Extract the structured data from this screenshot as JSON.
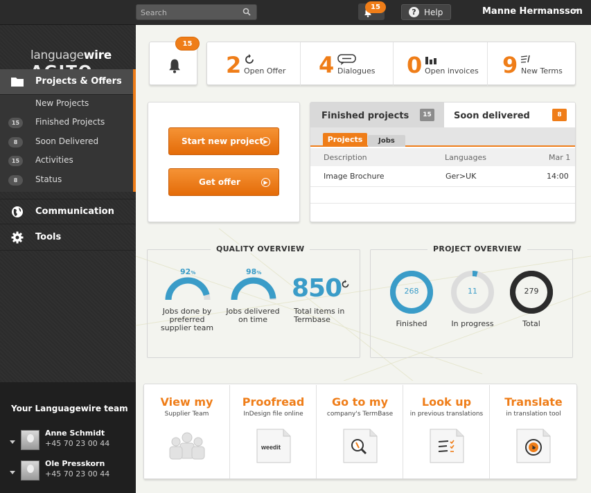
{
  "topbar": {
    "search_placeholder": "Search",
    "notification_count": "15",
    "help_label": "Help",
    "user_name": "Manne Hermansson"
  },
  "logo": {
    "line1_light": "language",
    "line1_bold": "wire",
    "line2": "AGITO"
  },
  "sidebar": {
    "projects_label": "Projects & Offers",
    "sub_items": [
      {
        "badge": "",
        "label": "New Projects"
      },
      {
        "badge": "15",
        "label": "Finished Projects"
      },
      {
        "badge": "8",
        "label": "Soon Delivered"
      },
      {
        "badge": "15",
        "label": "Activities"
      },
      {
        "badge": "8",
        "label": "Status"
      }
    ],
    "communication_label": "Communication",
    "tools_label": "Tools",
    "team_title": "Your Languagewire team",
    "team": [
      {
        "name": "Anne Schmidt",
        "phone": "+45 70 23 00 44"
      },
      {
        "name": "Ole Presskorn",
        "phone": "+45 70 23 00 44"
      }
    ]
  },
  "stats": {
    "bell_count": "15",
    "items": [
      {
        "value": "2",
        "label": "Open Offer",
        "icon": "refresh-icon"
      },
      {
        "value": "4",
        "label": "Dialogues",
        "icon": "speech-bubble-icon"
      },
      {
        "value": "0",
        "label": "Open invoices",
        "icon": "bar-chart-icon"
      },
      {
        "value": "9",
        "label": "New Terms",
        "icon": "list-pen-icon"
      }
    ]
  },
  "actions_card": {
    "start_label": "Start new project",
    "offer_label": "Get offer"
  },
  "projects_panel": {
    "finished_label": "Finished projects",
    "finished_count": "15",
    "soon_label": "Soon delivered",
    "soon_count": "8",
    "tab_projects": "Projects",
    "tab_jobs": "Jobs",
    "columns": {
      "description": "Description",
      "languages": "Languages",
      "date": "Mar 1"
    },
    "rows": [
      {
        "description": "Image Brochure",
        "languages": "Ger>UK",
        "time": "14:00"
      }
    ]
  },
  "quality": {
    "title": "QUALITY OVERVIEW",
    "gauges": [
      {
        "value": "92",
        "unit": "%",
        "fraction": 0.92,
        "label": "Jobs done by preferred supplier team"
      },
      {
        "value": "98",
        "unit": "%",
        "fraction": 0.98,
        "label": "Jobs delivered on time"
      }
    ],
    "total_value": "850",
    "total_label": "Total items in Termbase"
  },
  "project_overview": {
    "title": "PROJECT OVERVIEW",
    "donuts": [
      {
        "value": "268",
        "label": "Finished",
        "fraction": 1.0,
        "color": "#3a9cc8",
        "track": "#3a9cc8"
      },
      {
        "value": "11",
        "label": "In progress",
        "fraction": 0.04,
        "color": "#3a9cc8",
        "track": "#dcdcdc"
      },
      {
        "value": "279",
        "label": "Total",
        "fraction": 1.0,
        "color": "#2b2b2b",
        "track": "#2b2b2b"
      }
    ]
  },
  "quick_actions": [
    {
      "title": "View my",
      "subtitle": "Supplier Team",
      "icon": "team-icon"
    },
    {
      "title": "Proofread",
      "subtitle": "InDesign file online",
      "icon": "document-weedit-icon",
      "logo_text": "weedit"
    },
    {
      "title": "Go to my",
      "subtitle": "company's TermBase",
      "icon": "document-magnifier-icon"
    },
    {
      "title": "Look up",
      "subtitle": "in previous translations",
      "icon": "document-checklist-icon"
    },
    {
      "title": "Translate",
      "subtitle": "in translation tool",
      "icon": "document-globe-icon"
    }
  ],
  "colors": {
    "accent": "#ef7d18",
    "blue": "#3a9cc8",
    "dark": "#2b2b2b"
  }
}
